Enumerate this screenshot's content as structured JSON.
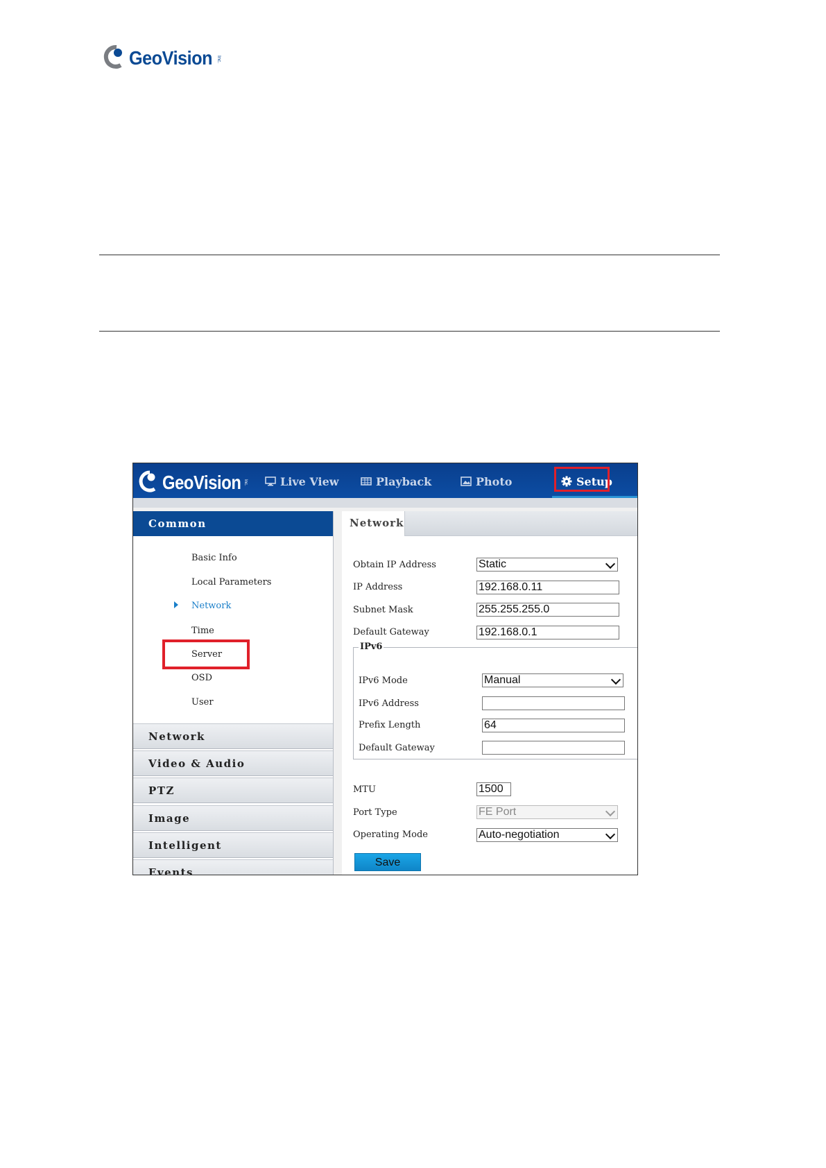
{
  "page": {
    "brand": "GeoVision",
    "brand_suffix": "Inc."
  },
  "app": {
    "brand": "GeoVision",
    "brand_suffix": "Inc.",
    "nav": [
      {
        "label": "Live View",
        "icon": "monitor-icon"
      },
      {
        "label": "Playback",
        "icon": "film-icon"
      },
      {
        "label": "Photo",
        "icon": "photo-icon"
      },
      {
        "label": "Setup",
        "icon": "gear-icon",
        "active": true
      }
    ],
    "accent_color": "#0b4a94",
    "highlight_color": "#e0202a"
  },
  "sidebar": {
    "header": "Common",
    "items": [
      "Basic Info",
      "Local Parameters",
      "Network",
      "Time",
      "Server",
      "OSD",
      "User"
    ],
    "active_item": "Network",
    "groups": [
      "Network",
      "Video & Audio",
      "PTZ",
      "Image",
      "Intelligent",
      "Events"
    ]
  },
  "content": {
    "tab": "Network",
    "obtain_ip_label": "Obtain IP Address",
    "obtain_ip_value": "Static",
    "ip_label": "IP Address",
    "ip_value": "192.168.0.11",
    "subnet_label": "Subnet Mask",
    "subnet_value": "255.255.255.0",
    "gateway_label": "Default Gateway",
    "gateway_value": "192.168.0.1",
    "ipv6": {
      "legend": "IPv6",
      "mode_label": "IPv6 Mode",
      "mode_value": "Manual",
      "address_label": "IPv6 Address",
      "address_value": "",
      "prefix_label": "Prefix Length",
      "prefix_value": "64",
      "gateway_label": "Default Gateway",
      "gateway_value": ""
    },
    "mtu_label": "MTU",
    "mtu_value": "1500",
    "port_type_label": "Port Type",
    "port_type_value": "FE Port",
    "operating_mode_label": "Operating Mode",
    "operating_mode_value": "Auto-negotiation",
    "save_label": "Save"
  }
}
